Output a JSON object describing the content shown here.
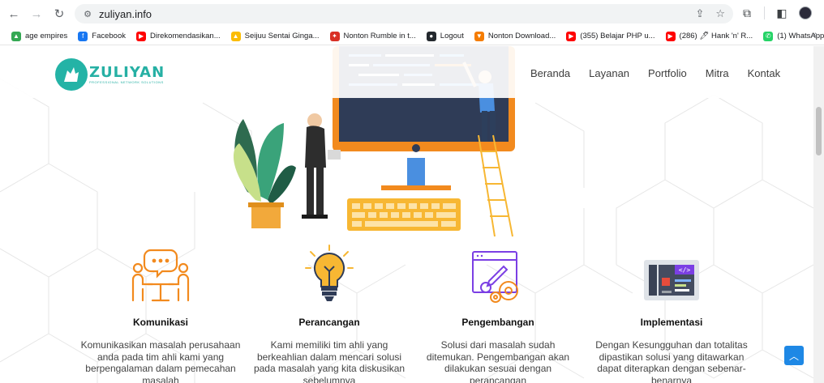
{
  "browser": {
    "url": "zuliyan.info",
    "bookmarks": [
      {
        "label": "age empires",
        "icon": "drive-icon",
        "color": "#34a853"
      },
      {
        "label": "Facebook",
        "icon": "facebook-icon",
        "color": "#1877f2"
      },
      {
        "label": "Direkomendasikan...",
        "icon": "youtube-icon",
        "color": "#ff0000"
      },
      {
        "label": "Seijuu Sentai Ginga...",
        "icon": "drive-icon",
        "color": "#fbbc04"
      },
      {
        "label": "Nonton Rumble in t...",
        "icon": "film-icon",
        "color": "#d93025"
      },
      {
        "label": "Logout",
        "icon": "github-icon",
        "color": "#24292e"
      },
      {
        "label": "Nonton Download...",
        "icon": "download-icon",
        "color": "#f57c00"
      },
      {
        "label": "(355) Belajar PHP u...",
        "icon": "youtube-icon",
        "color": "#ff0000"
      },
      {
        "label": "(286) 🖊 Hank 'n' R...",
        "icon": "youtube-icon",
        "color": "#ff0000"
      },
      {
        "label": "(1) WhatsApp",
        "icon": "whatsapp-icon",
        "color": "#25d366"
      }
    ],
    "more_label": "»"
  },
  "site": {
    "logo_title": "ZULIYAN",
    "logo_subtitle": "PROFESSIONAL NETWORK SOLUTIONS",
    "menu": [
      "Beranda",
      "Layanan",
      "Portfolio",
      "Mitra",
      "Kontak"
    ]
  },
  "services": [
    {
      "icon": "discussion-icon",
      "title": "Komunikasi",
      "text": "Komunikasikan masalah perusahaan anda pada tim ahli kami yang berpengalaman dalam pemecahan masalah"
    },
    {
      "icon": "lightbulb-icon",
      "title": "Perancangan",
      "text": "Kami memiliki tim ahli yang berkeahlian dalam mencari solusi pada masalah yang kita diskusikan sebelumnya"
    },
    {
      "icon": "development-icon",
      "title": "Pengembangan",
      "text": "Solusi dari masalah sudah ditemukan. Pengembangan akan dilakukan sesuai dengan perancangan"
    },
    {
      "icon": "implementation-icon",
      "title": "Implementasi",
      "text": "Dengan Kesungguhan dan totalitas dipastikan solusi yang ditawarkan dapat diterapkan dengan sebenar-benarnya"
    }
  ],
  "colors": {
    "brand": "#26b0a4",
    "back_to_top": "#1e88e5"
  }
}
